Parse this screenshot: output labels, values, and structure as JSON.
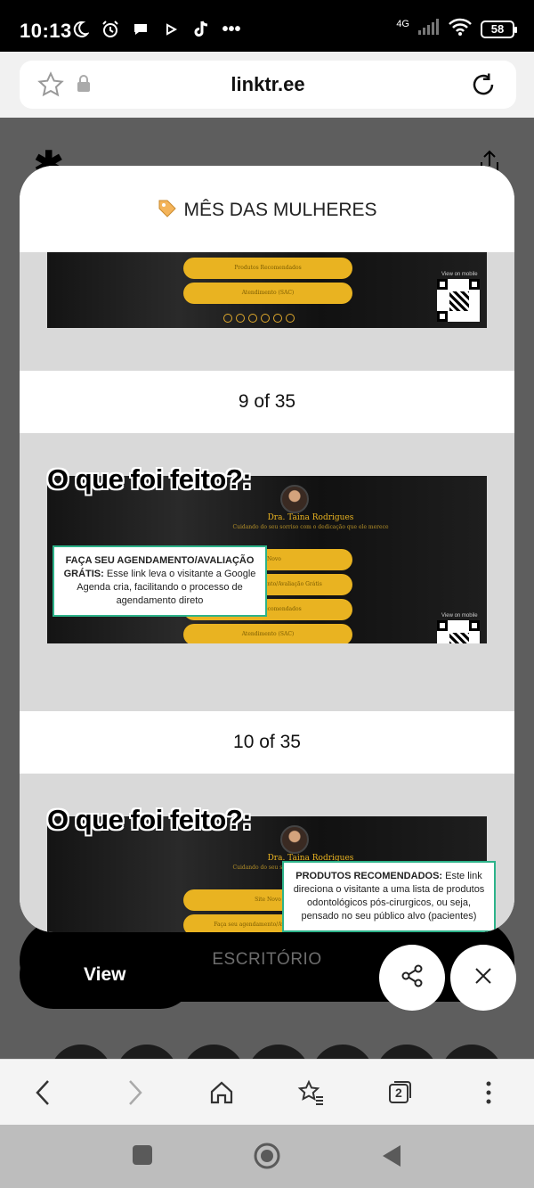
{
  "status_bar": {
    "time": "10:13",
    "network": "4G",
    "battery": "58"
  },
  "browser": {
    "url": "linktr.ee",
    "tab_count": "2"
  },
  "modal": {
    "title": "MÊS DAS MULHERES",
    "slides": [
      {
        "buttons": [
          "Produtos Recomendados",
          "Atendimento (SAC)"
        ],
        "view_on_mobile": "View on mobile",
        "caption": "9 of 35"
      },
      {
        "overlay_title": "O que foi feito?:",
        "doctor_name": "Dra. Taina Rodrigues",
        "doctor_sub": "Cuidando do seu sorriso com o dedicação que ele merece",
        "buttons": [
          "Site Novo",
          "Faça seu agendamento/Avaliação Grátis",
          "Produtos Recomendados",
          "Atendimento (SAC)"
        ],
        "annotation_bold": "FAÇA SEU AGENDAMENTO/AVALIAÇÃO GRÁTIS:",
        "annotation_text": "Esse link leva o visitante a Google Agenda cria, facilitando o processo de agendamento direto",
        "view_on_mobile": "View on mobile",
        "caption": "10 of 35"
      },
      {
        "overlay_title": "O que foi feito?:",
        "doctor_name": "Dra. Taina Rodrigues",
        "doctor_sub": "Cuidando do seu sorriso com o dedicação que ele merece",
        "buttons": [
          "Site Novo",
          "Faça seu agendamento/Avaliação Grátis"
        ],
        "annotation_bold": "PRODUTOS RECOMENDADOS:",
        "annotation_text": "Este link direciona o visitante a uma lista de produtos odontológicos pós-cirurgicos, ou seja, pensado no seu público alvo (pacientes)"
      }
    ]
  },
  "background_page": {
    "section_label": "ESCRITÓRIO",
    "view_button": "View"
  },
  "colors": {
    "accent_gold": "#e9b321",
    "annotation_border": "#2db38a"
  }
}
